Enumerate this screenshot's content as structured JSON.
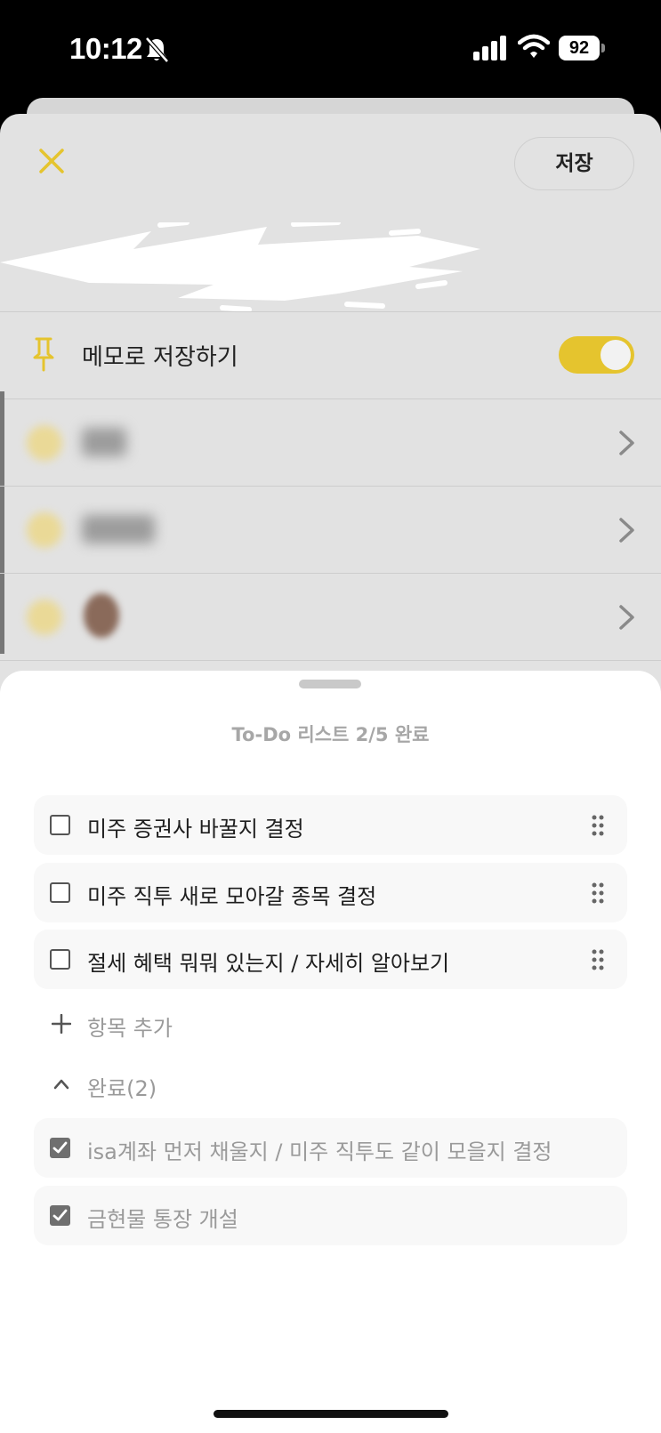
{
  "status_bar": {
    "time": "10:12",
    "battery": "92",
    "icons": [
      "bell-slash-icon",
      "cellular-signal-icon",
      "wifi-icon",
      "battery-icon"
    ]
  },
  "header": {
    "close_icon": "close-icon",
    "save_label": "저장"
  },
  "pin_row": {
    "icon": "pin-icon",
    "label": "메모로 저장하기",
    "toggle_on": true
  },
  "bottom_sheet": {
    "title": "To-Do 리스트 2/5 완료",
    "todo_items": [
      {
        "text": "미주 증권사 바꿀지 결정",
        "checked": false
      },
      {
        "text": "미주 직투 새로 모아갈 종목 결정",
        "checked": false
      },
      {
        "text": "절세 혜택 뭐뭐 있는지 / 자세히 알아보기",
        "checked": false
      }
    ],
    "add_item_label": "항목 추가",
    "done_header": "완료(2)",
    "done_items": [
      {
        "text": "isa계좌 먼저 채울지 / 미주 직투도 같이 모을지 결정",
        "checked": true
      },
      {
        "text": "금현물 통장 개설",
        "checked": true
      }
    ]
  },
  "colors": {
    "accent": "#E5C42E",
    "dim_background": "#E2E2E2",
    "muted_text": "#9A9A9A"
  }
}
